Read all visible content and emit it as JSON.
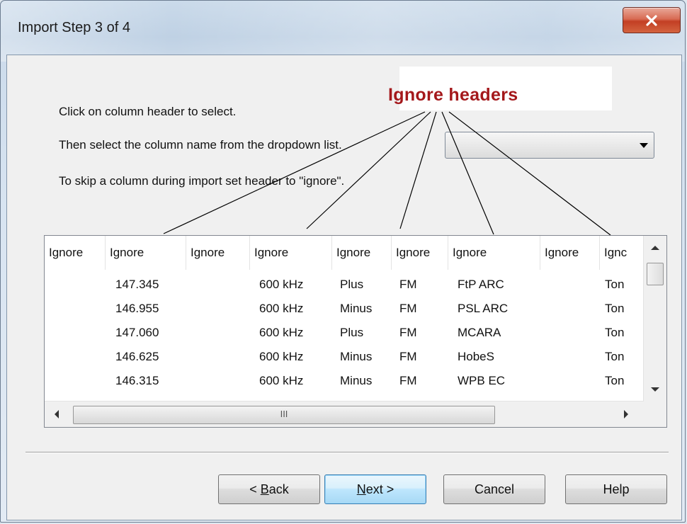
{
  "window": {
    "title": "Import Step 3 of 4"
  },
  "instructions": {
    "line1": "Click on column header to select.",
    "line2": "Then select the column name from the dropdown list.",
    "line3": "To skip a column during import set header to \"ignore\"."
  },
  "annotation": {
    "label": "Ignore headers",
    "color": "#a4181b"
  },
  "column_dropdown": {
    "selected": ""
  },
  "grid": {
    "headers": [
      "Ignore",
      "Ignore",
      "Ignore",
      "Ignore",
      "Ignore",
      "Ignore",
      "Ignore",
      "Ignore",
      "Ignc"
    ],
    "rows": [
      [
        "",
        "147.345",
        "",
        "600 kHz",
        "Plus",
        "FM",
        "FtP ARC",
        "",
        "Ton"
      ],
      [
        "",
        "146.955",
        "",
        "600 kHz",
        "Minus",
        "FM",
        "PSL ARC",
        "",
        "Ton"
      ],
      [
        "",
        "147.060",
        "",
        "600 kHz",
        "Plus",
        "FM",
        "MCARA",
        "",
        "Ton"
      ],
      [
        "",
        "146.625",
        "",
        "600 kHz",
        "Minus",
        "FM",
        "HobeS",
        "",
        "Ton"
      ],
      [
        "",
        "146.315",
        "",
        "600 kHz",
        "Minus",
        "FM",
        "WPB EC",
        "",
        "Ton"
      ]
    ],
    "hscroll_grip": "III"
  },
  "buttons": {
    "back_prefix": "< ",
    "back_key": "B",
    "back_rest": "ack",
    "next_key": "N",
    "next_rest": "ext >",
    "cancel": "Cancel",
    "help": "Help"
  },
  "icons": {
    "close": "close-icon",
    "dropdown": "chevron-down-icon"
  }
}
